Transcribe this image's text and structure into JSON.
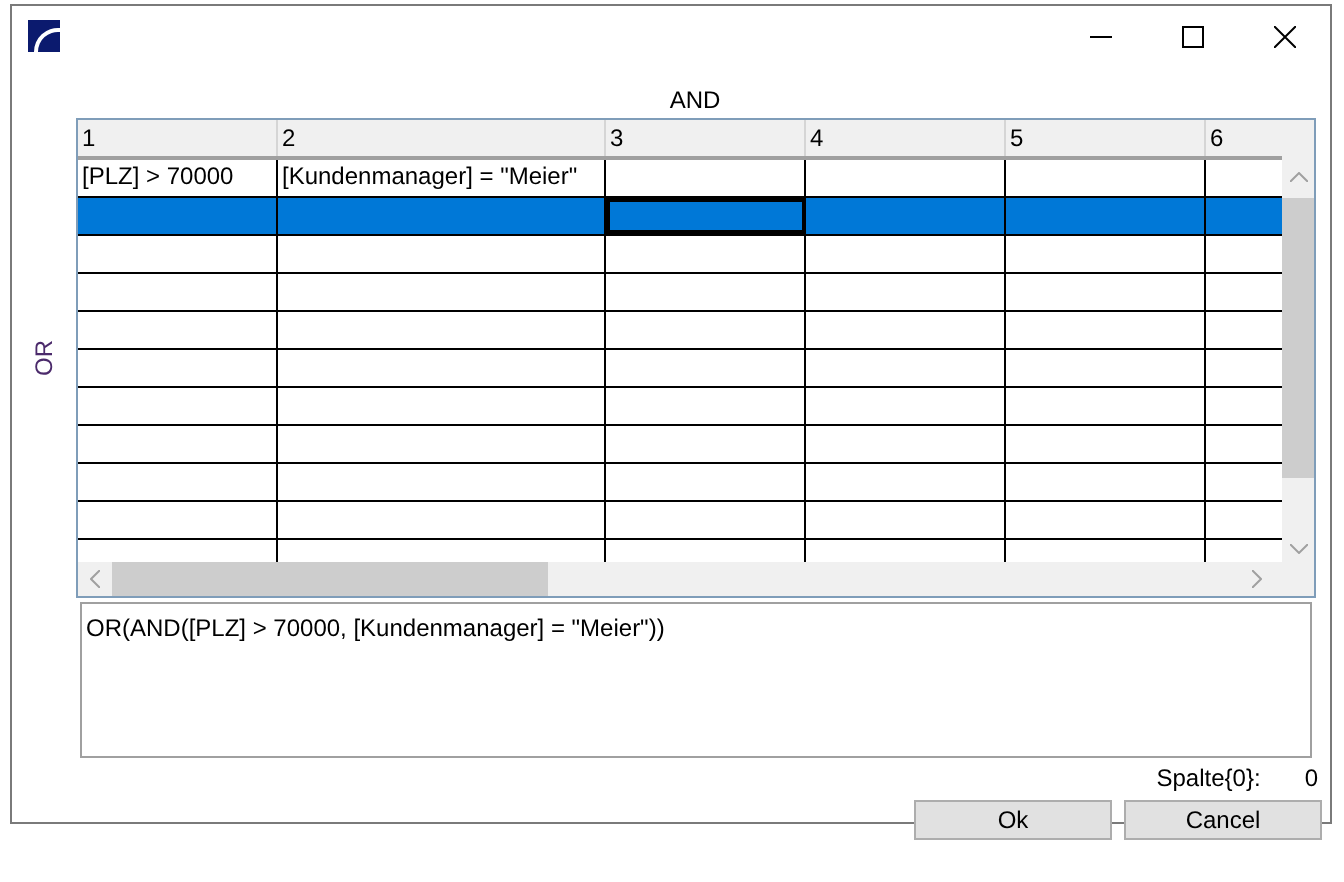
{
  "and_label": "AND",
  "or_label": "OR",
  "columns": [
    {
      "label": "1",
      "current": false
    },
    {
      "label": "2",
      "current": false
    },
    {
      "label": "3",
      "current": true
    },
    {
      "label": "4",
      "current": false
    },
    {
      "label": "5",
      "current": false
    },
    {
      "label": "6",
      "current": false
    }
  ],
  "rows": [
    {
      "selected": false,
      "cells": [
        "[PLZ] > 70000",
        "[Kundenmanager] = \"Meier\""
      ]
    },
    {
      "selected": true
    },
    {
      "selected": false
    },
    {
      "selected": false
    },
    {
      "selected": false
    },
    {
      "selected": false
    },
    {
      "selected": false
    },
    {
      "selected": false
    },
    {
      "selected": false
    },
    {
      "selected": false
    },
    {
      "selected": false
    }
  ],
  "expression": "OR(AND([PLZ] > 70000, [Kundenmanager] = \"Meier\"))",
  "column_label": "Spalte{0}:",
  "column_value": "0",
  "buttons": [
    "Ok",
    "Cancel"
  ]
}
